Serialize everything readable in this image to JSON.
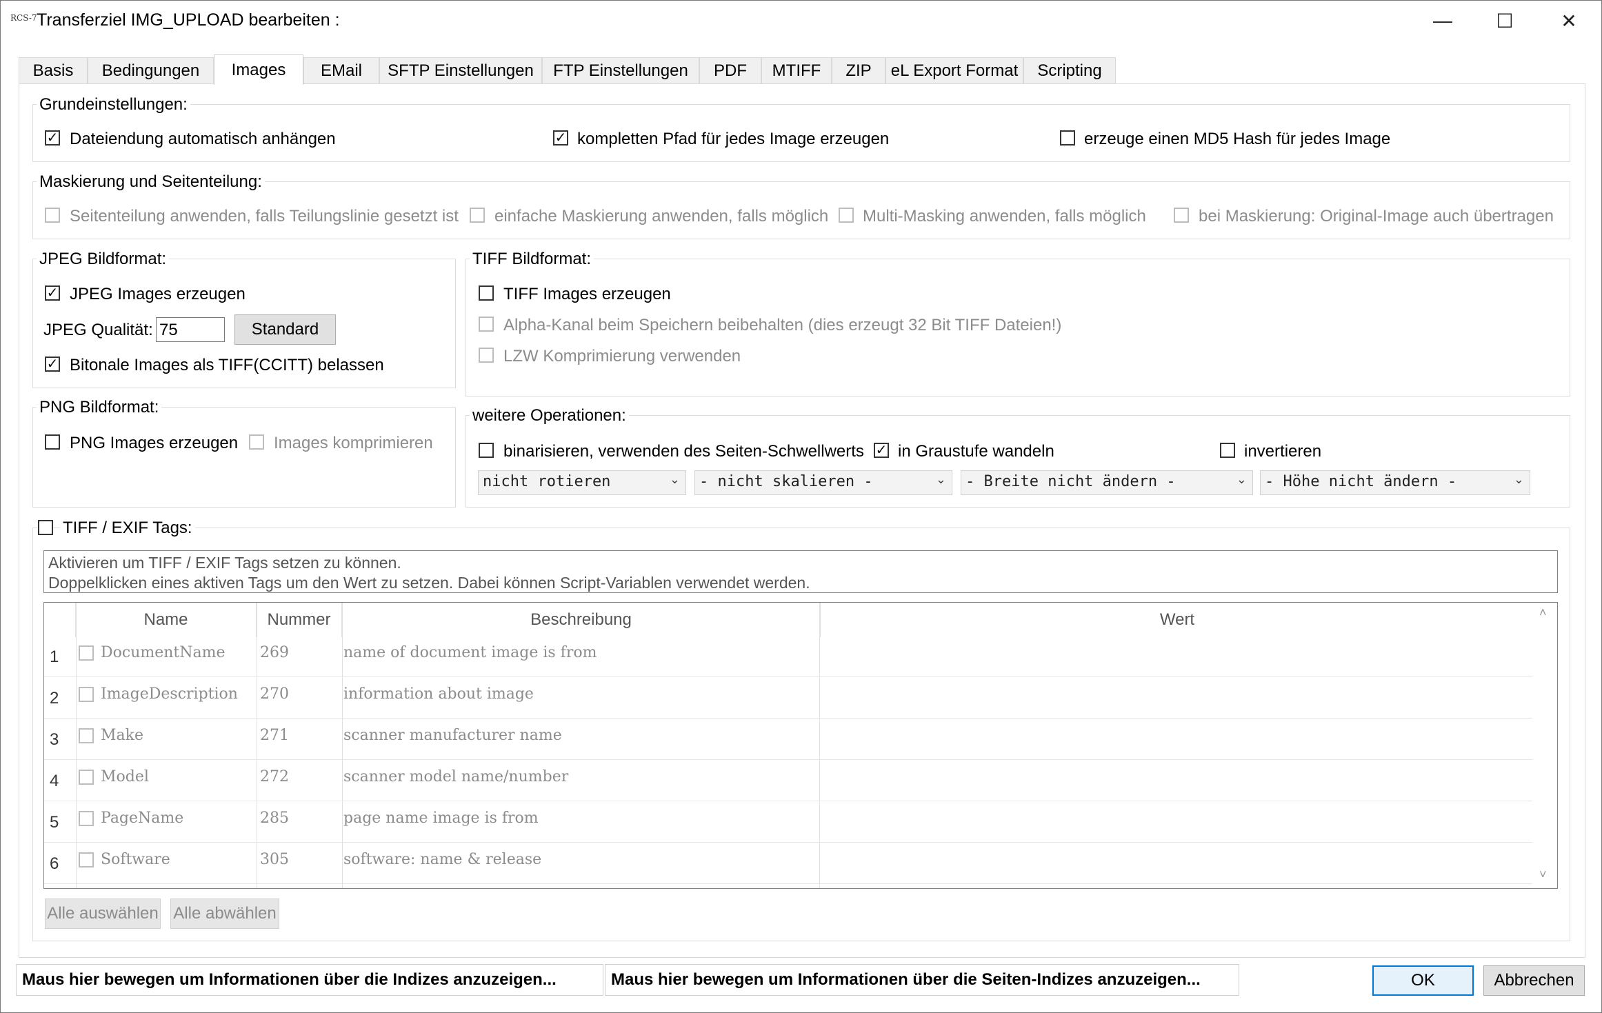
{
  "window": {
    "app_logo": "RCS-7",
    "title": "Transferziel IMG_UPLOAD bearbeiten :",
    "minimize_icon": "—",
    "maximize_icon": "☐",
    "close_icon": "✕"
  },
  "tabs": [
    "Basis",
    "Bedingungen",
    "Images",
    "EMail",
    "SFTP Einstellungen",
    "FTP Einstellungen",
    "PDF",
    "MTIFF",
    "ZIP",
    "eL Export Format",
    "Scripting"
  ],
  "active_tab": "Images",
  "grund": {
    "title": "Grundeinstellungen:",
    "dateiendung": "Dateiendung automatisch anhängen",
    "pfad": "kompletten Pfad für jedes Image erzeugen",
    "md5": "erzeuge einen MD5 Hash für jedes Image",
    "dateiendung_checked": true,
    "pfad_checked": true,
    "md5_checked": false
  },
  "mask": {
    "title": "Maskierung und Seitenteilung:",
    "seitenteilung": "Seitenteilung anwenden, falls Teilungslinie gesetzt ist",
    "einfach": "einfache Maskierung anwenden, falls möglich",
    "multi": "Multi-Masking anwenden, falls möglich",
    "original": "bei Maskierung: Original-Image auch übertragen"
  },
  "jpeg": {
    "title": "JPEG Bildformat:",
    "erzeugen": "JPEG Images erzeugen",
    "erzeugen_checked": true,
    "qualitaet_label": "JPEG Qualität:",
    "qualitaet_value": "75",
    "standard_button": "Standard",
    "bitonal": "Bitonale Images als TIFF(CCITT) belassen",
    "bitonal_checked": true
  },
  "tiff": {
    "title": "TIFF Bildformat:",
    "erzeugen": "TIFF Images erzeugen",
    "alpha": "Alpha-Kanal beim Speichern beibehalten (dies erzeugt 32 Bit TIFF Dateien!)",
    "lzw": "LZW Komprimierung verwenden"
  },
  "png": {
    "title": "PNG Bildformat:",
    "erzeugen": "PNG Images erzeugen",
    "komprimieren": "Images komprimieren"
  },
  "ops": {
    "title": "weitere Operationen:",
    "binarisieren": "binarisieren, verwenden des Seiten-Schwellwerts",
    "graustufe": "in Graustufe wandeln",
    "graustufe_checked": true,
    "invertieren": "invertieren",
    "rotate": "nicht rotieren",
    "scale": "- nicht skalieren -",
    "width": "- Breite nicht ändern -",
    "height": "- Höhe nicht ändern -"
  },
  "exif": {
    "title": "TIFF / EXIF Tags:",
    "info_line1": "Aktivieren um TIFF / EXIF Tags setzen zu können.",
    "info_line2": "Doppelklicken eines aktiven Tags um den Wert zu setzen. Dabei können Script-Variablen verwendet werden.",
    "columns": [
      "Name",
      "Nummer",
      "Beschreibung",
      "Wert"
    ],
    "rows": [
      {
        "n": "1",
        "name": "DocumentName",
        "num": "269",
        "desc": "name of document image is from",
        "wert": ""
      },
      {
        "n": "2",
        "name": "ImageDescription",
        "num": "270",
        "desc": "information about image",
        "wert": ""
      },
      {
        "n": "3",
        "name": "Make",
        "num": "271",
        "desc": "scanner manufacturer name",
        "wert": ""
      },
      {
        "n": "4",
        "name": "Model",
        "num": "272",
        "desc": "scanner model name/number",
        "wert": ""
      },
      {
        "n": "5",
        "name": "PageName",
        "num": "285",
        "desc": "page name image is from",
        "wert": ""
      },
      {
        "n": "6",
        "name": "Software",
        "num": "305",
        "desc": "software: name & release",
        "wert": ""
      }
    ],
    "select_all": "Alle auswählen",
    "deselect_all": "Alle abwählen"
  },
  "footer": {
    "indizes": "Maus hier bewegen um Informationen über die Indizes anzuzeigen...",
    "seiten_indizes": "Maus hier bewegen um Informationen über die Seiten-Indizes anzuzeigen...",
    "ok": "OK",
    "cancel": "Abbrechen"
  },
  "check_glyph": "✓"
}
